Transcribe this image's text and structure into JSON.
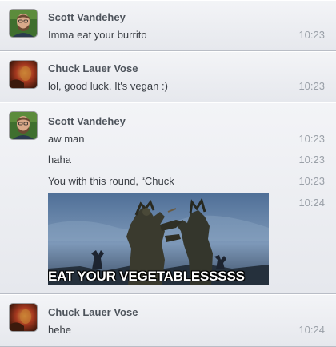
{
  "groups": [
    {
      "sender": "Scott Vandehey",
      "avatar_icon": "scott-avatar",
      "messages": [
        {
          "text": "Imma eat your burrito",
          "time": "10:23"
        }
      ]
    },
    {
      "sender": "Chuck Lauer Vose",
      "avatar_icon": "chuck-avatar",
      "messages": [
        {
          "text": "lol, good luck. It's vegan :)",
          "time": "10:23"
        }
      ]
    },
    {
      "sender": "Scott Vandehey",
      "avatar_icon": "scott-avatar",
      "messages": [
        {
          "text": "aw man",
          "time": "10:23"
        },
        {
          "text": "haha",
          "time": "10:23"
        },
        {
          "text": "You with this round, “Chuck",
          "time": "10:23"
        },
        {
          "image_caption": "EAT YOUR VEGETABLESSSSS",
          "time": "10:24"
        }
      ]
    },
    {
      "sender": "Chuck Lauer Vose",
      "avatar_icon": "chuck-avatar",
      "messages": [
        {
          "text": "hehe",
          "time": "10:24"
        }
      ]
    }
  ],
  "colors": {
    "sender": "#4e545c",
    "message": "#3a3e44",
    "timestamp": "#9aa0a8"
  }
}
